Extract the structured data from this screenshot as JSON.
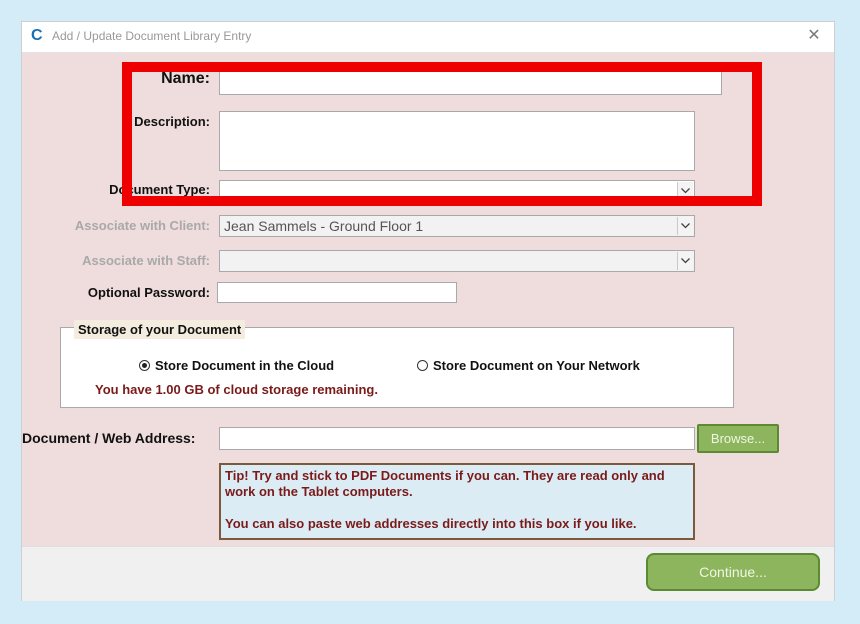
{
  "window": {
    "title": "Add / Update Document Library Entry",
    "close_glyph": "✕"
  },
  "form": {
    "name_label": "Name:",
    "name_value": "",
    "description_label": "Description:",
    "description_value": "",
    "document_type_label": "Document Type:",
    "document_type_value": "",
    "client_label": "Associate with Client:",
    "client_value": "Jean Sammels - Ground Floor 1",
    "staff_label": "Associate with Staff:",
    "staff_value": "",
    "password_label": "Optional Password:",
    "password_value": ""
  },
  "storage": {
    "legend": "Storage of your Document",
    "option_cloud": "Store Document in the Cloud",
    "option_network": "Store Document on Your Network",
    "selected": "cloud",
    "remaining_text": "You have 1.00 GB of cloud storage remaining."
  },
  "address": {
    "label": "Document / Web Address:",
    "value": "",
    "browse_label": "Browse..."
  },
  "tip": {
    "line1": "Tip! Try and stick to PDF Documents if you can.  They are read only and work on the Tablet computers.",
    "line2": "You can also paste web addresses directly into this box if you like."
  },
  "footer": {
    "continue_label": "Continue..."
  },
  "colors": {
    "page_bg": "#d4ecf8",
    "form_bg": "#efdcdc",
    "highlight": "#ee0000",
    "button_green": "#8db55d",
    "tip_text": "#7a1a1a"
  },
  "icons": {
    "app": "app-logo-icon",
    "close": "close-icon",
    "dropdown": "chevron-down-icon"
  }
}
